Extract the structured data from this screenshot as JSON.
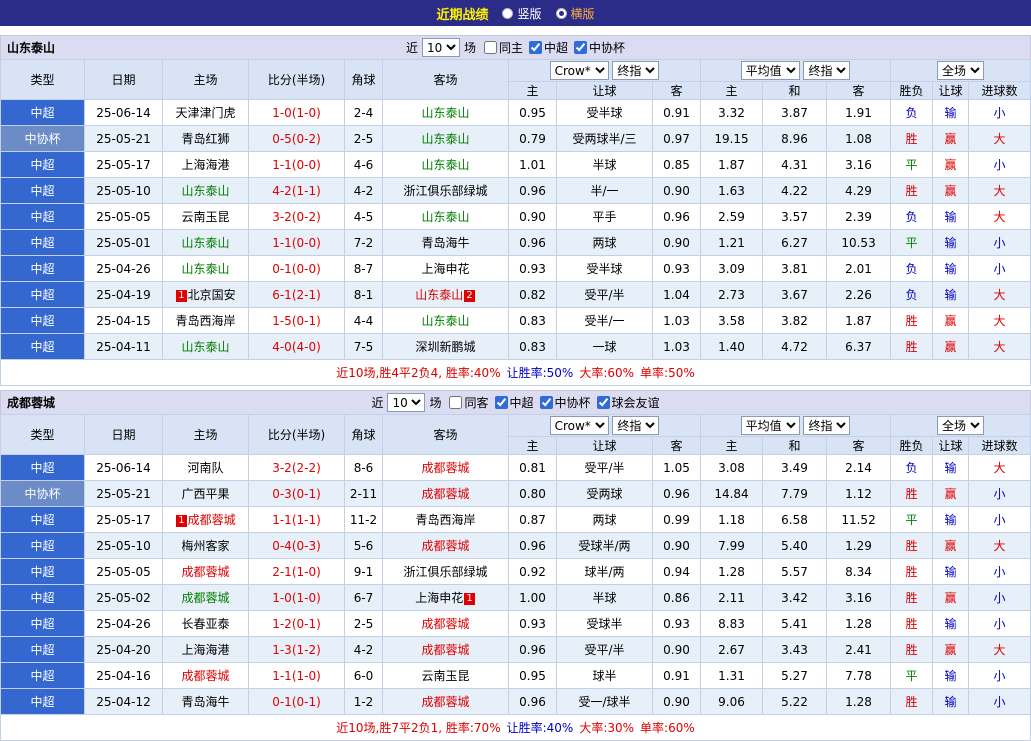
{
  "colors": {
    "topbar_bg": "#2B2C87",
    "title_yellow": "#FFF000",
    "selected_option_orange": "#FFAC3C",
    "section_bg": "#DBDBF1",
    "header_bg": "#D8E4F5",
    "row_alt_bg": "#E7EFF9",
    "league_cell_blue": "#3567D1",
    "cup_cell_blue": "#6C8CC8",
    "win_red": "#E00000",
    "draw_green": "#008000",
    "loss_blue": "#0000C8"
  },
  "top_bar": {
    "title": "近期战绩",
    "layout_options": [
      {
        "label": "竖版",
        "selected": false
      },
      {
        "label": "横版",
        "selected": true
      }
    ]
  },
  "table_header": {
    "base_cols": [
      "类型",
      "日期",
      "主场",
      "比分(半场)",
      "角球",
      "客场"
    ],
    "group1": {
      "selects": [
        "Crow*",
        "终指"
      ],
      "cols": [
        "主",
        "让球",
        "客"
      ]
    },
    "group2": {
      "selects": [
        "平均值",
        "终指"
      ],
      "cols": [
        "主",
        "和",
        "客"
      ]
    },
    "group3": {
      "selects": [
        "全场"
      ],
      "cols": [
        "胜负",
        "让球",
        "进球数"
      ]
    }
  },
  "tables": [
    {
      "team": "山东泰山",
      "filter": {
        "near_label": "近",
        "count": "10",
        "games_label": "场",
        "checkboxes": [
          {
            "label": "同主",
            "checked": false
          },
          {
            "label": "中超",
            "checked": true
          },
          {
            "label": "中协杯",
            "checked": true
          }
        ]
      },
      "rows": [
        {
          "type": "中超",
          "cup": false,
          "date": "25-06-14",
          "home": {
            "name": "天津津门虎"
          },
          "score": "1-0(1-0)",
          "corner": "2-4",
          "away": {
            "name": "山东泰山",
            "color": "green"
          },
          "odds": [
            "0.95",
            "受半球",
            "0.91"
          ],
          "avg": [
            "3.32",
            "3.87",
            "1.91"
          ],
          "res": [
            [
              "负",
              "blue"
            ],
            [
              "输",
              "blue"
            ],
            [
              "小",
              "blue"
            ]
          ]
        },
        {
          "type": "中协杯",
          "cup": true,
          "date": "25-05-21",
          "home": {
            "name": "青岛红狮"
          },
          "score": "0-5(0-2)",
          "corner": "2-5",
          "away": {
            "name": "山东泰山",
            "color": "green"
          },
          "odds": [
            "0.79",
            "受两球半/三",
            "0.97"
          ],
          "avg": [
            "19.15",
            "8.96",
            "1.08"
          ],
          "res": [
            [
              "胜",
              "red"
            ],
            [
              "赢",
              "red"
            ],
            [
              "大",
              "red"
            ]
          ]
        },
        {
          "type": "中超",
          "cup": false,
          "date": "25-05-17",
          "home": {
            "name": "上海海港"
          },
          "score": "1-1(0-0)",
          "corner": "4-6",
          "away": {
            "name": "山东泰山",
            "color": "green"
          },
          "odds": [
            "1.01",
            "半球",
            "0.85"
          ],
          "avg": [
            "1.87",
            "4.31",
            "3.16"
          ],
          "res": [
            [
              "平",
              "green"
            ],
            [
              "赢",
              "red"
            ],
            [
              "小",
              "blue"
            ]
          ]
        },
        {
          "type": "中超",
          "cup": false,
          "date": "25-05-10",
          "home": {
            "name": "山东泰山",
            "color": "green"
          },
          "score": "4-2(1-1)",
          "corner": "4-2",
          "away": {
            "name": "浙江俱乐部绿城"
          },
          "odds": [
            "0.96",
            "半/一",
            "0.90"
          ],
          "avg": [
            "1.63",
            "4.22",
            "4.29"
          ],
          "res": [
            [
              "胜",
              "red"
            ],
            [
              "赢",
              "red"
            ],
            [
              "大",
              "red"
            ]
          ]
        },
        {
          "type": "中超",
          "cup": false,
          "date": "25-05-05",
          "home": {
            "name": "云南玉昆"
          },
          "score": "3-2(0-2)",
          "corner": "4-5",
          "away": {
            "name": "山东泰山",
            "color": "green"
          },
          "odds": [
            "0.90",
            "平手",
            "0.96"
          ],
          "avg": [
            "2.59",
            "3.57",
            "2.39"
          ],
          "res": [
            [
              "负",
              "blue"
            ],
            [
              "输",
              "blue"
            ],
            [
              "大",
              "red"
            ]
          ]
        },
        {
          "type": "中超",
          "cup": false,
          "date": "25-05-01",
          "home": {
            "name": "山东泰山",
            "color": "green"
          },
          "score": "1-1(0-0)",
          "corner": "7-2",
          "away": {
            "name": "青岛海牛"
          },
          "odds": [
            "0.96",
            "两球",
            "0.90"
          ],
          "avg": [
            "1.21",
            "6.27",
            "10.53"
          ],
          "res": [
            [
              "平",
              "green"
            ],
            [
              "输",
              "blue"
            ],
            [
              "小",
              "blue"
            ]
          ]
        },
        {
          "type": "中超",
          "cup": false,
          "date": "25-04-26",
          "home": {
            "name": "山东泰山",
            "color": "green"
          },
          "score": "0-1(0-0)",
          "corner": "8-7",
          "away": {
            "name": "上海申花"
          },
          "odds": [
            "0.93",
            "受半球",
            "0.93"
          ],
          "avg": [
            "3.09",
            "3.81",
            "2.01"
          ],
          "res": [
            [
              "负",
              "blue"
            ],
            [
              "输",
              "blue"
            ],
            [
              "小",
              "blue"
            ]
          ]
        },
        {
          "type": "中超",
          "cup": false,
          "date": "25-04-19",
          "home": {
            "name": "北京国安",
            "badge_before": "1"
          },
          "score": "6-1(2-1)",
          "corner": "8-1",
          "away": {
            "name": "山东泰山",
            "color": "red",
            "badge_after": "2"
          },
          "odds": [
            "0.82",
            "受平/半",
            "1.04"
          ],
          "avg": [
            "2.73",
            "3.67",
            "2.26"
          ],
          "res": [
            [
              "负",
              "blue"
            ],
            [
              "输",
              "blue"
            ],
            [
              "大",
              "red"
            ]
          ]
        },
        {
          "type": "中超",
          "cup": false,
          "date": "25-04-15",
          "home": {
            "name": "青岛西海岸"
          },
          "score": "1-5(0-1)",
          "corner": "4-4",
          "away": {
            "name": "山东泰山",
            "color": "green"
          },
          "odds": [
            "0.83",
            "受半/一",
            "1.03"
          ],
          "avg": [
            "3.58",
            "3.82",
            "1.87"
          ],
          "res": [
            [
              "胜",
              "red"
            ],
            [
              "赢",
              "red"
            ],
            [
              "大",
              "red"
            ]
          ]
        },
        {
          "type": "中超",
          "cup": false,
          "date": "25-04-11",
          "home": {
            "name": "山东泰山",
            "color": "green"
          },
          "score": "4-0(4-0)",
          "corner": "7-5",
          "away": {
            "name": "深圳新鹏城"
          },
          "odds": [
            "0.83",
            "一球",
            "1.03"
          ],
          "avg": [
            "1.40",
            "4.72",
            "6.37"
          ],
          "res": [
            [
              "胜",
              "red"
            ],
            [
              "赢",
              "red"
            ],
            [
              "大",
              "red"
            ]
          ]
        }
      ],
      "summary": [
        {
          "text": "近10场,胜4平2负4, 胜率:40%",
          "color": "red"
        },
        {
          "text": "让胜率:50%",
          "color": "blue"
        },
        {
          "text": "大率:60%",
          "color": "red"
        },
        {
          "text": "单率:50%",
          "color": "red"
        }
      ]
    },
    {
      "team": "成都蓉城",
      "filter": {
        "near_label": "近",
        "count": "10",
        "games_label": "场",
        "checkboxes": [
          {
            "label": "同客",
            "checked": false
          },
          {
            "label": "中超",
            "checked": true
          },
          {
            "label": "中协杯",
            "checked": true
          },
          {
            "label": "球会友谊",
            "checked": true
          }
        ]
      },
      "rows": [
        {
          "type": "中超",
          "cup": false,
          "date": "25-06-14",
          "home": {
            "name": "河南队"
          },
          "score": "3-2(2-2)",
          "corner": "8-6",
          "away": {
            "name": "成都蓉城",
            "color": "red"
          },
          "odds": [
            "0.81",
            "受平/半",
            "1.05"
          ],
          "avg": [
            "3.08",
            "3.49",
            "2.14"
          ],
          "res": [
            [
              "负",
              "blue"
            ],
            [
              "输",
              "blue"
            ],
            [
              "大",
              "red"
            ]
          ]
        },
        {
          "type": "中协杯",
          "cup": true,
          "date": "25-05-21",
          "home": {
            "name": "广西平果"
          },
          "score": "0-3(0-1)",
          "corner": "2-11",
          "away": {
            "name": "成都蓉城",
            "color": "red"
          },
          "odds": [
            "0.80",
            "受两球",
            "0.96"
          ],
          "avg": [
            "14.84",
            "7.79",
            "1.12"
          ],
          "res": [
            [
              "胜",
              "red"
            ],
            [
              "赢",
              "red"
            ],
            [
              "小",
              "blue"
            ]
          ]
        },
        {
          "type": "中超",
          "cup": false,
          "date": "25-05-17",
          "home": {
            "name": "成都蓉城",
            "color": "red",
            "badge_before": "1"
          },
          "score": "1-1(1-1)",
          "corner": "11-2",
          "away": {
            "name": "青岛西海岸"
          },
          "odds": [
            "0.87",
            "两球",
            "0.99"
          ],
          "avg": [
            "1.18",
            "6.58",
            "11.52"
          ],
          "res": [
            [
              "平",
              "green"
            ],
            [
              "输",
              "blue"
            ],
            [
              "小",
              "blue"
            ]
          ]
        },
        {
          "type": "中超",
          "cup": false,
          "date": "25-05-10",
          "home": {
            "name": "梅州客家"
          },
          "score": "0-4(0-3)",
          "corner": "5-6",
          "away": {
            "name": "成都蓉城",
            "color": "red"
          },
          "odds": [
            "0.96",
            "受球半/两",
            "0.90"
          ],
          "avg": [
            "7.99",
            "5.40",
            "1.29"
          ],
          "res": [
            [
              "胜",
              "red"
            ],
            [
              "赢",
              "red"
            ],
            [
              "大",
              "red"
            ]
          ]
        },
        {
          "type": "中超",
          "cup": false,
          "date": "25-05-05",
          "home": {
            "name": "成都蓉城",
            "color": "red"
          },
          "score": "2-1(1-0)",
          "corner": "9-1",
          "away": {
            "name": "浙江俱乐部绿城"
          },
          "odds": [
            "0.92",
            "球半/两",
            "0.94"
          ],
          "avg": [
            "1.28",
            "5.57",
            "8.34"
          ],
          "res": [
            [
              "胜",
              "red"
            ],
            [
              "输",
              "blue"
            ],
            [
              "小",
              "blue"
            ]
          ]
        },
        {
          "type": "中超",
          "cup": false,
          "date": "25-05-02",
          "home": {
            "name": "成都蓉城",
            "color": "green"
          },
          "score": "1-0(1-0)",
          "corner": "6-7",
          "away": {
            "name": "上海申花",
            "badge_after": "1"
          },
          "odds": [
            "1.00",
            "半球",
            "0.86"
          ],
          "avg": [
            "2.11",
            "3.42",
            "3.16"
          ],
          "res": [
            [
              "胜",
              "red"
            ],
            [
              "赢",
              "red"
            ],
            [
              "小",
              "blue"
            ]
          ]
        },
        {
          "type": "中超",
          "cup": false,
          "date": "25-04-26",
          "home": {
            "name": "长春亚泰"
          },
          "score": "1-2(0-1)",
          "corner": "2-5",
          "away": {
            "name": "成都蓉城",
            "color": "red"
          },
          "odds": [
            "0.93",
            "受球半",
            "0.93"
          ],
          "avg": [
            "8.83",
            "5.41",
            "1.28"
          ],
          "res": [
            [
              "胜",
              "red"
            ],
            [
              "输",
              "blue"
            ],
            [
              "小",
              "blue"
            ]
          ]
        },
        {
          "type": "中超",
          "cup": false,
          "date": "25-04-20",
          "home": {
            "name": "上海海港"
          },
          "score": "1-3(1-2)",
          "corner": "4-2",
          "away": {
            "name": "成都蓉城",
            "color": "red"
          },
          "odds": [
            "0.96",
            "受平/半",
            "0.90"
          ],
          "avg": [
            "2.67",
            "3.43",
            "2.41"
          ],
          "res": [
            [
              "胜",
              "red"
            ],
            [
              "赢",
              "red"
            ],
            [
              "大",
              "red"
            ]
          ]
        },
        {
          "type": "中超",
          "cup": false,
          "date": "25-04-16",
          "home": {
            "name": "成都蓉城",
            "color": "red"
          },
          "score": "1-1(1-0)",
          "corner": "6-0",
          "away": {
            "name": "云南玉昆"
          },
          "odds": [
            "0.95",
            "球半",
            "0.91"
          ],
          "avg": [
            "1.31",
            "5.27",
            "7.78"
          ],
          "res": [
            [
              "平",
              "green"
            ],
            [
              "输",
              "blue"
            ],
            [
              "小",
              "blue"
            ]
          ]
        },
        {
          "type": "中超",
          "cup": false,
          "date": "25-04-12",
          "home": {
            "name": "青岛海牛"
          },
          "score": "0-1(0-1)",
          "corner": "1-2",
          "away": {
            "name": "成都蓉城",
            "color": "red"
          },
          "odds": [
            "0.96",
            "受一/球半",
            "0.90"
          ],
          "avg": [
            "9.06",
            "5.22",
            "1.28"
          ],
          "res": [
            [
              "胜",
              "red"
            ],
            [
              "输",
              "blue"
            ],
            [
              "小",
              "blue"
            ]
          ]
        }
      ],
      "summary": [
        {
          "text": "近10场,胜7平2负1, 胜率:70%",
          "color": "red"
        },
        {
          "text": "让胜率:40%",
          "color": "blue"
        },
        {
          "text": "大率:30%",
          "color": "red"
        },
        {
          "text": "单率:60%",
          "color": "red"
        }
      ]
    }
  ]
}
